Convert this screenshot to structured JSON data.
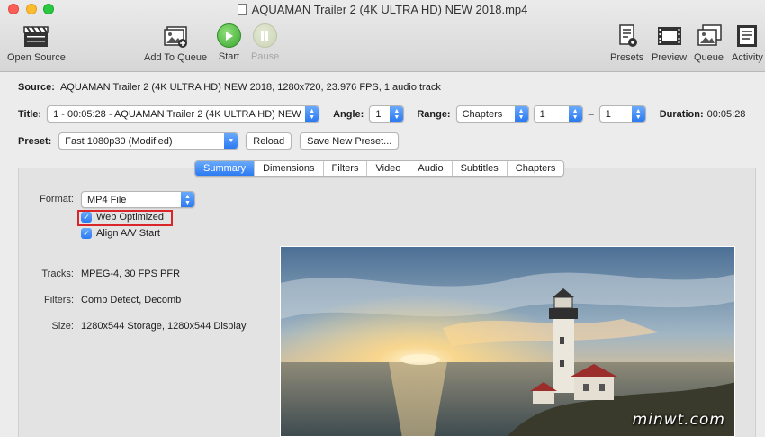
{
  "window": {
    "title": "AQUAMAN Trailer 2 (4K ULTRA HD) NEW 2018.mp4"
  },
  "toolbar": {
    "open_source": "Open Source",
    "add_to_queue": "Add To Queue",
    "start": "Start",
    "pause": "Pause",
    "presets": "Presets",
    "preview": "Preview",
    "queue": "Queue",
    "activity": "Activity"
  },
  "source": {
    "label": "Source:",
    "value": "AQUAMAN Trailer 2 (4K ULTRA HD) NEW 2018, 1280x720, 23.976 FPS, 1 audio track"
  },
  "title_row": {
    "label": "Title:",
    "title_value": "1 - 00:05:28 - AQUAMAN Trailer 2 (4K ULTRA HD) NEW",
    "angle_label": "Angle:",
    "angle_value": "1",
    "range_label": "Range:",
    "range_value": "Chapters",
    "range_start": "1",
    "range_dash": "–",
    "range_end": "1",
    "duration_label": "Duration:",
    "duration_value": "00:05:28"
  },
  "preset_row": {
    "label": "Preset:",
    "value": "Fast 1080p30 (Modified)",
    "reload": "Reload",
    "save_new": "Save New Preset..."
  },
  "tabs": [
    "Summary",
    "Dimensions",
    "Filters",
    "Video",
    "Audio",
    "Subtitles",
    "Chapters"
  ],
  "summary": {
    "format_label": "Format:",
    "format_value": "MP4 File",
    "web_optimized": "Web Optimized",
    "align_av": "Align A/V Start",
    "tracks_label": "Tracks:",
    "tracks_value": "MPEG-4, 30 FPS PFR",
    "filters_label": "Filters:",
    "filters_value": "Comb Detect, Decomb",
    "size_label": "Size:",
    "size_value": "1280x544 Storage, 1280x544 Display"
  },
  "watermark": "minwt.com",
  "colors": {
    "accent": "#2b7af2",
    "highlight_border": "#d8262a",
    "start_green": "#3aa52f"
  }
}
